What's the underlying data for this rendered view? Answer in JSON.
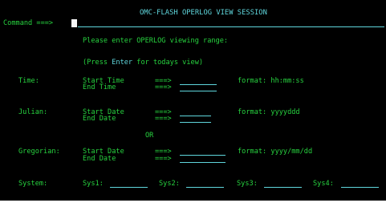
{
  "header": {
    "title": "OMC-FLASH OPERLOG VIEW SESSION",
    "command_label": "Command ===>"
  },
  "prompts": {
    "range": "Please enter OPERLOG viewing range:",
    "press_prefix": "(Press ",
    "press_key": "Enter",
    "press_suffix": " for todays view)",
    "or": "OR"
  },
  "sections": {
    "time": {
      "label": "Time:",
      "start": "Start Time",
      "end": "End Time",
      "arrow": "===>",
      "format": "format: hh:mm:ss"
    },
    "julian": {
      "label": "Julian:",
      "start": "Start Date",
      "end": "End Date",
      "arrow": "===>",
      "format": "format: yyyyddd"
    },
    "gregorian": {
      "label": "Gregorian:",
      "start": "Start Date",
      "end": "End Date",
      "arrow": "===>",
      "format": "format: yyyy/mm/dd"
    }
  },
  "system": {
    "label": "System:",
    "sys1": "Sys1:",
    "sys2": "Sys2:",
    "sys3": "Sys3:",
    "sys4": "Sys4:"
  },
  "colors": {
    "background": "#000000",
    "label_green": "#27d23f",
    "input_cyan": "#5fd6dc",
    "cursor_white": "#f3f3f3"
  }
}
